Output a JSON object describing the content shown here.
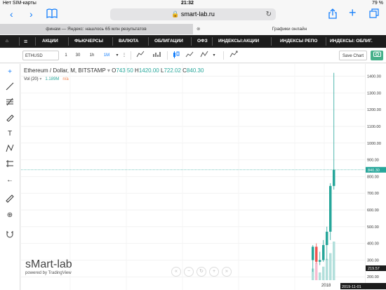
{
  "status_bar": {
    "carrier": "Нет SIM-карты",
    "time": "21:32",
    "battery": "79 %"
  },
  "browser": {
    "url": "smart-lab.ru"
  },
  "tabs": [
    {
      "label": "финам — Яндекс: нашлось 65 млн результатов"
    },
    {
      "label": "Графики онлайн"
    }
  ],
  "menu": [
    "АКЦИИ",
    "ФЬЮЧЕРСЫ",
    "ВАЛЮТА",
    "ОБЛИГАЦИИ",
    "ОФЗ",
    "ИНДЕКСЫ:АКЦИИ",
    "ИНДЕКСЫ РЕПО",
    "ИНДЕКСЫ: ОБЛИГ."
  ],
  "toolbar": {
    "symbol": "ETHUSD",
    "intervals": [
      "1",
      "30",
      "1h",
      "1M"
    ],
    "active_interval": "1M",
    "save_label": "Save Chart"
  },
  "legend": {
    "title": "Ethereum / Dollar, M, BITSTAMP",
    "o_label": "O",
    "o": "743.50",
    "h_label": "H",
    "h": "1420.00",
    "l_label": "L",
    "l": "722.02",
    "c_label": "C",
    "c": "840.30",
    "vol_label": "Vol (20)",
    "vol_value": "1.189M",
    "vol_ma": "n/a"
  },
  "watermark": {
    "brand": "sMart-lab",
    "powered": "powered by TradingView"
  },
  "colors": {
    "up": "#26a69a",
    "down": "#ef5350",
    "accent": "#147efb"
  },
  "chart_data": {
    "type": "candlestick",
    "price_axis_ticks": [
      "1400.00",
      "1300.00",
      "1200.00",
      "1100.00",
      "1000.00",
      "900.00",
      "800.00",
      "700.00",
      "600.00",
      "500.00",
      "400.00",
      "300.00",
      "200.00"
    ],
    "x_ticks": [
      "2018"
    ],
    "last_price_label": "840.30",
    "low_label": "219.57",
    "date_label": "2019-11-01",
    "ylim": [
      180,
      1440
    ],
    "candles": [
      {
        "o": 300,
        "h": 390,
        "l": 230,
        "c": 380
      },
      {
        "o": 380,
        "h": 400,
        "l": 280,
        "c": 290
      },
      {
        "o": 290,
        "h": 350,
        "l": 270,
        "c": 300
      },
      {
        "o": 300,
        "h": 420,
        "l": 290,
        "c": 390
      },
      {
        "o": 390,
        "h": 500,
        "l": 300,
        "c": 470
      },
      {
        "o": 470,
        "h": 760,
        "l": 420,
        "c": 743.5
      },
      {
        "o": 743.5,
        "h": 1420,
        "l": 722.02,
        "c": 840.3
      }
    ],
    "volumes": [
      0.3,
      0.45,
      0.2,
      0.35,
      0.55,
      0.7,
      1.0
    ]
  }
}
